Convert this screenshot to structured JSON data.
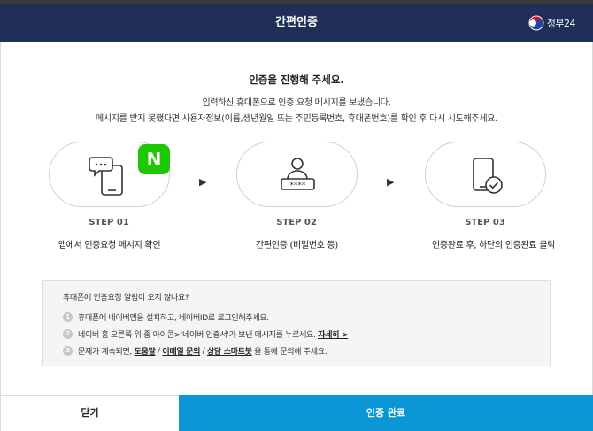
{
  "header": {
    "title": "간편인증",
    "logo_text": "정부24"
  },
  "main": {
    "title": "인증을 진행해 주세요.",
    "desc_line1": "입력하신 휴대폰으로 인증 요청 메시지를 보냈습니다.",
    "desc_line2": "메시지를 받지 못했다면 사용자정보(이름,생년월일 또는 주민등록번호, 휴대폰번호)를 확인 후 다시 시도해주세요."
  },
  "badge": {
    "letter": "N",
    "color": "#1ec800"
  },
  "steps": [
    {
      "label": "STEP 01",
      "caption": "앱에서 인증요청 메시지 확인",
      "icon": "phone-message-icon"
    },
    {
      "label": "STEP 02",
      "caption": "간편인증 (비밀번호 등)",
      "icon": "user-password-icon"
    },
    {
      "label": "STEP 03",
      "caption": "인증완료 후, 하단의 인증완료 클릭",
      "icon": "phone-check-icon"
    }
  ],
  "arrow_glyph": "▶",
  "notice": {
    "title": "휴대폰에 인증요청 알림이 오지 않나요?",
    "items": [
      {
        "num": "1",
        "text": "휴대폰에 네이버앱을 설치하고, 네이버ID로 로그인해주세요."
      },
      {
        "num": "2",
        "text": "네이버 홈 오른쪽 위 종 아이콘>'네이버 인증서'가 보낸 메시지를 누르세요.",
        "link": "자세히 >"
      },
      {
        "num": "3",
        "text_before": "문제가 계속되면, ",
        "link1": "도움말",
        "sep1": " / ",
        "link2": "이메일 문의",
        "sep2": " / ",
        "link3": "상담 스마트봇",
        "text_after": " 을 통해 문의해 주세요."
      }
    ]
  },
  "footer": {
    "close_label": "닫기",
    "done_label": "인증 완료"
  },
  "colors": {
    "header_bg": "#1f2f56",
    "primary_button": "#0b97d6"
  }
}
